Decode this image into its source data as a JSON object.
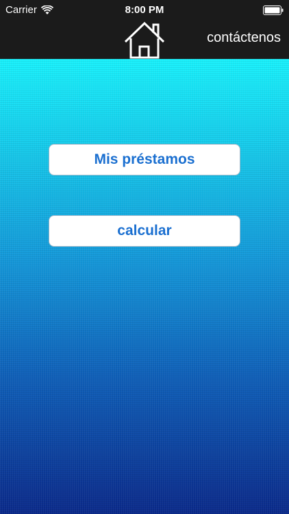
{
  "status_bar": {
    "carrier": "Carrier",
    "time": "8:00 PM"
  },
  "nav": {
    "home_icon": "home-icon",
    "contact_label": "contáctenos"
  },
  "menu": {
    "loans_label": "Mis préstamos",
    "calc_label": "calcular"
  },
  "colors": {
    "bar_background": "#1b1b1b",
    "button_text": "#1a6fd0",
    "gradient_top": "#19f0fb",
    "gradient_bottom": "#0b2a8a"
  }
}
